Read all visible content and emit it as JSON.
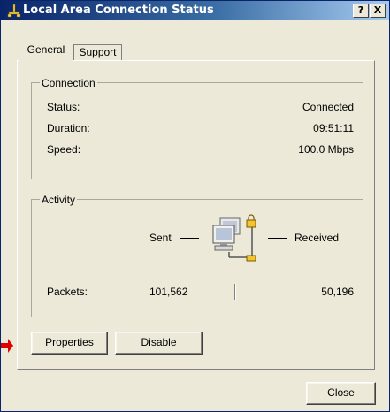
{
  "window": {
    "title": "Local Area Connection Status",
    "help_btn": "?",
    "close_btn": "X",
    "titlebar_gradient_start": "#0a246a",
    "face_color": "#ece9d8"
  },
  "tabs": [
    {
      "label": "General",
      "selected": true
    },
    {
      "label": "Support",
      "selected": false
    }
  ],
  "connection": {
    "legend": "Connection",
    "rows": [
      {
        "label": "Status:",
        "value": "Connected"
      },
      {
        "label": "Duration:",
        "value": "09:51:11"
      },
      {
        "label": "Speed:",
        "value": "100.0 Mbps"
      }
    ]
  },
  "activity": {
    "legend": "Activity",
    "sent_label": "Sent",
    "received_label": "Received",
    "packets_label": "Packets:",
    "packets_sent": "101,562",
    "packets_received": "50,196",
    "graphic_icon": "network-computers-icon"
  },
  "buttons": {
    "properties": "Properties",
    "disable": "Disable",
    "close": "Close"
  },
  "pointer": {
    "icon": "red-arrow-pointer-icon",
    "color": "#e00000"
  }
}
